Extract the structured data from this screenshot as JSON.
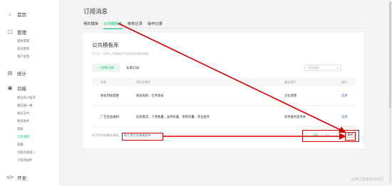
{
  "sidebar": {
    "top_items": [
      {
        "icon": "home-icon",
        "label": "首页"
      },
      {
        "icon": "management-icon",
        "label": "管理"
      },
      {
        "icon": "stats-icon",
        "label": "统计"
      },
      {
        "icon": "function-icon",
        "label": "功能"
      },
      {
        "icon": "develop-icon",
        "label": "开发"
      }
    ],
    "management_items": [
      "版本管理",
      "成员管理",
      "用户反馈"
    ],
    "function_items": [
      "附近的小程序",
      "微信搜一搜",
      "微信支付",
      "物流助手",
      "客服",
      "订阅消息",
      "直播",
      "页面内容接入",
      "小程序插件"
    ],
    "active_item": "订阅消息"
  },
  "main": {
    "title": "订阅消息",
    "tabs": [
      "我的模板",
      "公共模板库",
      "审核记录",
      "操作记录"
    ],
    "active_tab": "公共模板库"
  },
  "card": {
    "title": "公共模板库",
    "description": "你可从下方的公共模板库中选用你所需的模板",
    "segments": [
      "一次性订阅",
      "长期订阅"
    ],
    "search_placeholder": "搜索模板",
    "columns": [
      "标题",
      "常见关键词",
      "服务类目",
      "操作"
    ],
    "rows": [
      {
        "title": "收益到账提醒",
        "keywords": "收益规则，任务收益",
        "category": "企业管理",
        "action": "选用"
      },
      {
        "title": "广告投放通知",
        "keywords": "投放需求，卡券数量，发券码量，用券码量，券主服务",
        "category": "软件服务提供商",
        "action": "选用"
      }
    ],
    "footer_text": "找不到你想要的模板",
    "help_link": "帮忙我们完善模板库",
    "pager": {
      "prev": "<",
      "current": "181",
      "separator": "/",
      "total": "181",
      "next": ">",
      "jump": "跳转"
    }
  },
  "watermark": "@稀土掘金技术社区",
  "colors": {
    "accent": "#07c160",
    "link": "#576b95",
    "annotation": "#d00000"
  }
}
